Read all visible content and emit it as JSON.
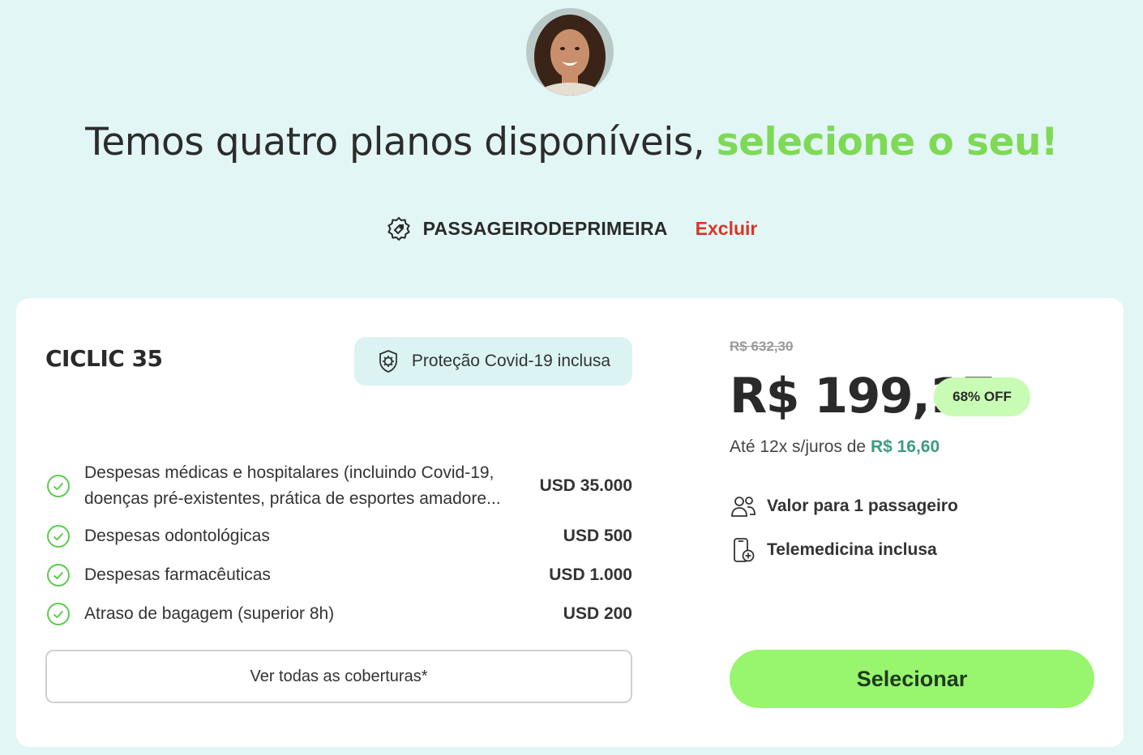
{
  "header": {
    "avatar_alt": "avatar",
    "headline": "Temos quatro planos disponíveis,",
    "headline_accent": "selecione o seu!"
  },
  "coupon": {
    "icon": "tag-icon",
    "code": "PASSAGEIRODEPRIMEIRA",
    "remove_label": "Excluir"
  },
  "plan": {
    "name": "CICLIC 35",
    "covid_badge": "Proteção Covid-19 inclusa",
    "coverages": [
      {
        "label": "Despesas médicas e hospitalares (incluindo Covid-19, doenças pré-existentes, prática de esportes amadore...",
        "value": "USD 35.000"
      },
      {
        "label": "Despesas odontológicas",
        "value": "USD 500"
      },
      {
        "label": "Despesas farmacêuticas",
        "value": "USD 1.000"
      },
      {
        "label": "Atraso de bagagem (superior 8h)",
        "value": "USD 200"
      }
    ],
    "all_coverages_label": "Ver todas as coberturas*",
    "old_price": "R$ 632,30",
    "price": "R$ 199,17",
    "discount": "68% OFF",
    "installments_prefix": "Até 12x s/juros de ",
    "installments_value": "R$ 16,60",
    "features": [
      {
        "icon": "users-icon",
        "label": "Valor para 1 passageiro"
      },
      {
        "icon": "telemedicine-icon",
        "label": "Telemedicina inclusa"
      }
    ],
    "select_label": "Selecionar"
  },
  "colors": {
    "background": "#e2f6f5",
    "accent_green": "#7ed957",
    "remove_red": "#d9352a",
    "select_button": "#98f56e",
    "discount_badge": "#c8fbb3",
    "installment_value": "#3e9a80"
  }
}
